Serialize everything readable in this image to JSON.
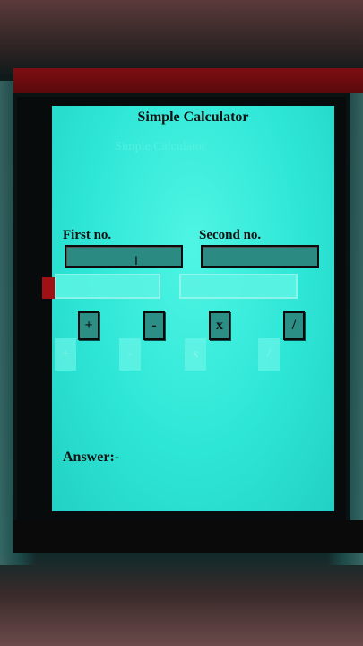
{
  "app": {
    "title": "Simple Calculator"
  },
  "fields": {
    "first_label": "First no.",
    "second_label": "Second no.",
    "first_value": "",
    "second_value": ""
  },
  "operators": [
    {
      "label": "+",
      "op": "add"
    },
    {
      "label": "-",
      "op": "subtract"
    },
    {
      "label": "x",
      "op": "multiply"
    },
    {
      "label": "/",
      "op": "divide"
    }
  ],
  "result": {
    "label": "Answer:-",
    "value": ""
  },
  "colors": {
    "screen": "#2ee6d6",
    "input": "#2b8a82",
    "button": "#2c8f86",
    "red_bar": "#7d0e12"
  }
}
